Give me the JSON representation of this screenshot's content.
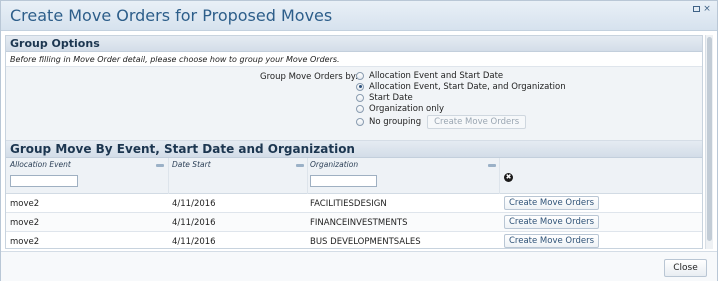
{
  "dialog": {
    "title": "Create Move Orders for Proposed Moves",
    "maximize_icon": "maximize-icon",
    "close_icon_glyph": "×"
  },
  "group_options": {
    "header": "Group Options",
    "instructions": "Before filling in Move Order detail, please choose how to group your Move Orders.",
    "group_by_label": "Group Move Orders by:",
    "options": [
      {
        "label": "Allocation Event and Start Date",
        "checked": false
      },
      {
        "label": "Allocation Event, Start Date, and Organization",
        "checked": true
      },
      {
        "label": "Start Date",
        "checked": false
      },
      {
        "label": "Organization only",
        "checked": false
      },
      {
        "label": "No grouping",
        "checked": false
      }
    ],
    "inline_button": "Create Move Orders"
  },
  "grid": {
    "header": "Group Move By Event, Start Date and Organization",
    "columns": [
      "Allocation Event",
      "Date Start",
      "Organization"
    ],
    "clear_icon_glyph": "✖",
    "rows": [
      {
        "event": "move2",
        "date": "4/11/2016",
        "org": "FACILITIESDESIGN",
        "button": "Create Move Orders"
      },
      {
        "event": "move2",
        "date": "4/11/2016",
        "org": "FINANCEINVESTMENTS",
        "button": "Create Move Orders"
      },
      {
        "event": "move2",
        "date": "4/11/2016",
        "org": "BUS DEVELOPMENTSALES",
        "button": "Create Move Orders"
      }
    ]
  },
  "footer": {
    "close_label": "Close"
  },
  "colors": {
    "title": "#2d5e8a",
    "header_bg": "#d3dde8",
    "button_text": "#2e5277"
  }
}
